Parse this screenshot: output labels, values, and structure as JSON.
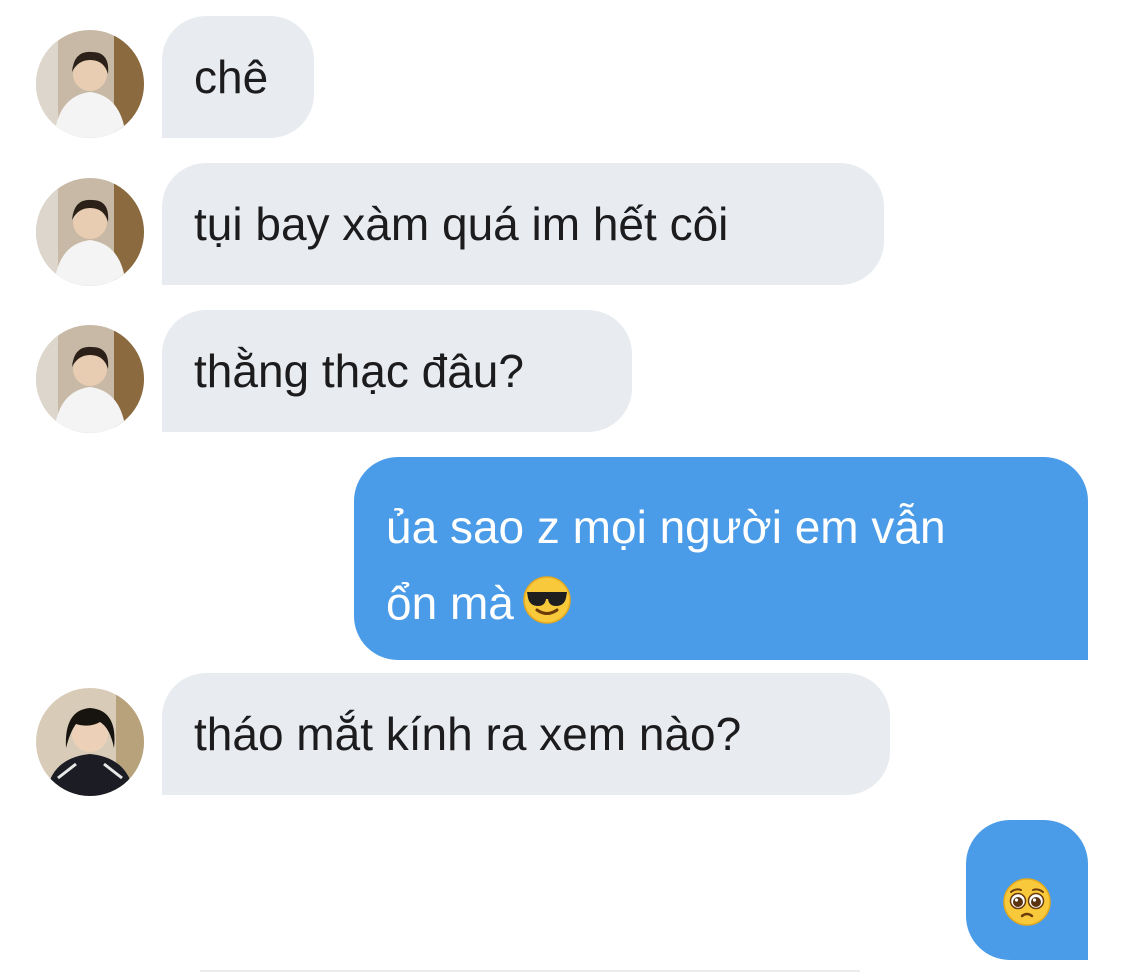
{
  "conversation": {
    "messages": [
      {
        "direction": "incoming",
        "text": "chê",
        "avatar": "user-photo-white-shirt"
      },
      {
        "direction": "incoming",
        "text": "tụi bay xàm quá im hết côi",
        "avatar": "user-photo-white-shirt"
      },
      {
        "direction": "incoming",
        "text": "thằng thạc đâu?",
        "avatar": "user-photo-white-shirt"
      },
      {
        "direction": "outgoing",
        "line1": "ủa sao z mọi người em vẫn",
        "line2": "ổn mà",
        "emoji": "smiling-face-with-sunglasses"
      },
      {
        "direction": "incoming",
        "text": "tháo mắt kính ra xem nào?",
        "avatar": "user-photo-dark-jacket"
      },
      {
        "direction": "outgoing",
        "emoji": "pleading-face"
      }
    ]
  },
  "colors": {
    "incoming_bubble": "#e8ebef",
    "outgoing_bubble": "#4a9be8",
    "text_dark": "#1c1c1e",
    "text_light": "#ffffff"
  }
}
